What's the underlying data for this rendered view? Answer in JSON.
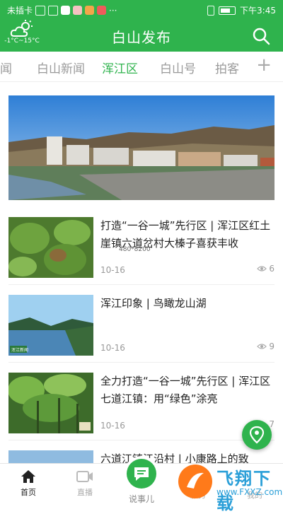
{
  "status_bar": {
    "carrier": "未插卡",
    "time": "下午3:45"
  },
  "header": {
    "title": "白山发布",
    "weather_range": "-1°C~15°C"
  },
  "tabs": [
    {
      "label": "闻",
      "active": false
    },
    {
      "label": "白山新闻",
      "active": false
    },
    {
      "label": "浑江区",
      "active": true
    },
    {
      "label": "白山号",
      "active": false
    },
    {
      "label": "拍客",
      "active": false
    }
  ],
  "news": [
    {
      "title": "打造“一谷一城”先行区 | 浑江区红土崖镇六道岔村大榛子喜获丰收",
      "date": "10-16",
      "views": "6"
    },
    {
      "title": "浑江印象 | 鸟瞰龙山湖",
      "date": "10-16",
      "views": "9"
    },
    {
      "title": "全力打造“一谷一城”先行区 | 浑江区七道江镇：用“绿色”涂亮",
      "date": "10-16",
      "views": "7"
    },
    {
      "title": "六道江镇江沿村 | 小康路上的致",
      "date": "",
      "views": ""
    }
  ],
  "overlay_text": "480*8200",
  "thumb_caption": "浑江新闻",
  "bottom_nav": {
    "home": "首页",
    "live": "直播",
    "talk": "说事儿",
    "service": "服务",
    "mine": "我的"
  },
  "watermark": {
    "brand": "飞翔下载",
    "url": "www.FXXZ.com"
  },
  "colors": {
    "brand_green": "#2fb34d",
    "watermark_blue": "#2a9fd8"
  },
  "icons": [
    "weather-cloud-sun-icon",
    "search-icon",
    "eye-icon",
    "location-pin-icon",
    "home-icon",
    "video-icon",
    "chat-icon"
  ]
}
